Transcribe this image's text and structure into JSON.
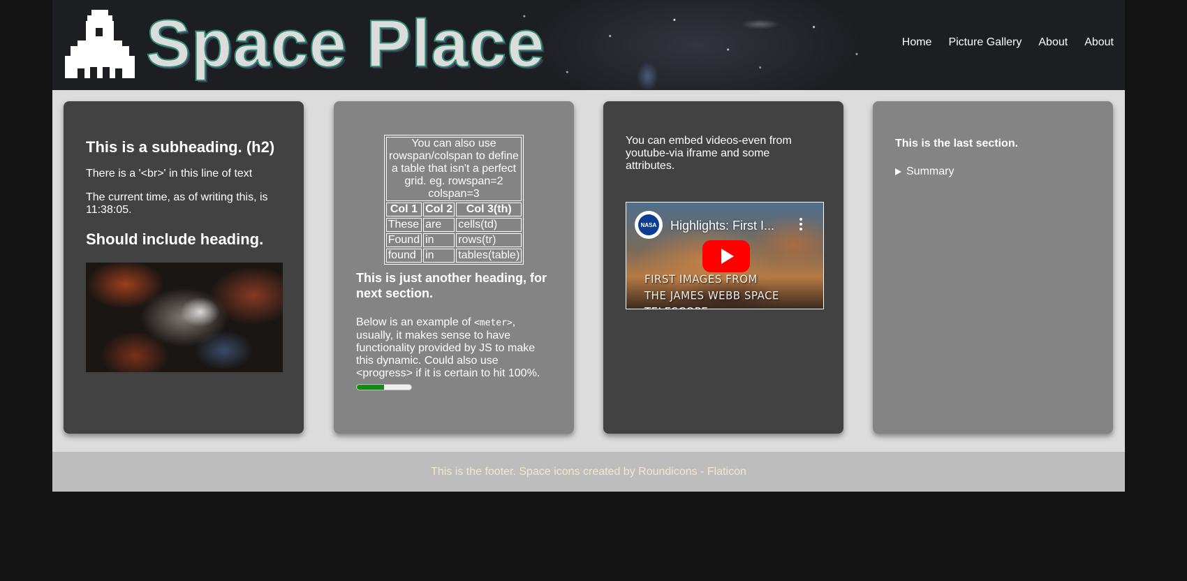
{
  "header": {
    "site_title": "Space Place",
    "nav": [
      "Home",
      "Picture Gallery",
      "About",
      "About"
    ]
  },
  "card1": {
    "subheading": "This is a subheading. (h2)",
    "line1": "There is a '<br>' in this line of text",
    "line2": "The current time, as of writing this, is 11:38:05.",
    "heading2": "Should include heading."
  },
  "card2": {
    "table_caption": "You can also use rowspan/colspan to define a table that isn't a perfect grid. eg. rowspan=2 colspan=3",
    "table_headers": [
      "Col 1",
      "Col 2",
      "Col 3(th)"
    ],
    "table_rows": [
      [
        "These",
        "are",
        "cells(td)"
      ],
      [
        "Found",
        "in",
        "rows(tr)"
      ],
      [
        "found",
        "in",
        "tables(table)"
      ]
    ],
    "heading": "This is just another heading, for next section.",
    "text_before_code": "Below is an example of ",
    "code": "<meter>",
    "text_after_code": ", usually, it makes sense to have functionality provided by JS to make this dynamic. Could also use <progress> if it is certain to hit 100%.",
    "meter_value": 0.5
  },
  "card3": {
    "text": "You can embed videos-even from youtube-via iframe and some attributes.",
    "video": {
      "channel": "NASA",
      "title": "Highlights: First I...",
      "caption_line1": "FIRST IMAGES FROM",
      "caption_line2": "THE JAMES WEBB SPACE TELESCOPE"
    }
  },
  "card4": {
    "text": "This is the last section.",
    "summary": "Summary"
  },
  "footer": {
    "text": "This is the footer. Space icons created by Roundicons - Flaticon"
  }
}
